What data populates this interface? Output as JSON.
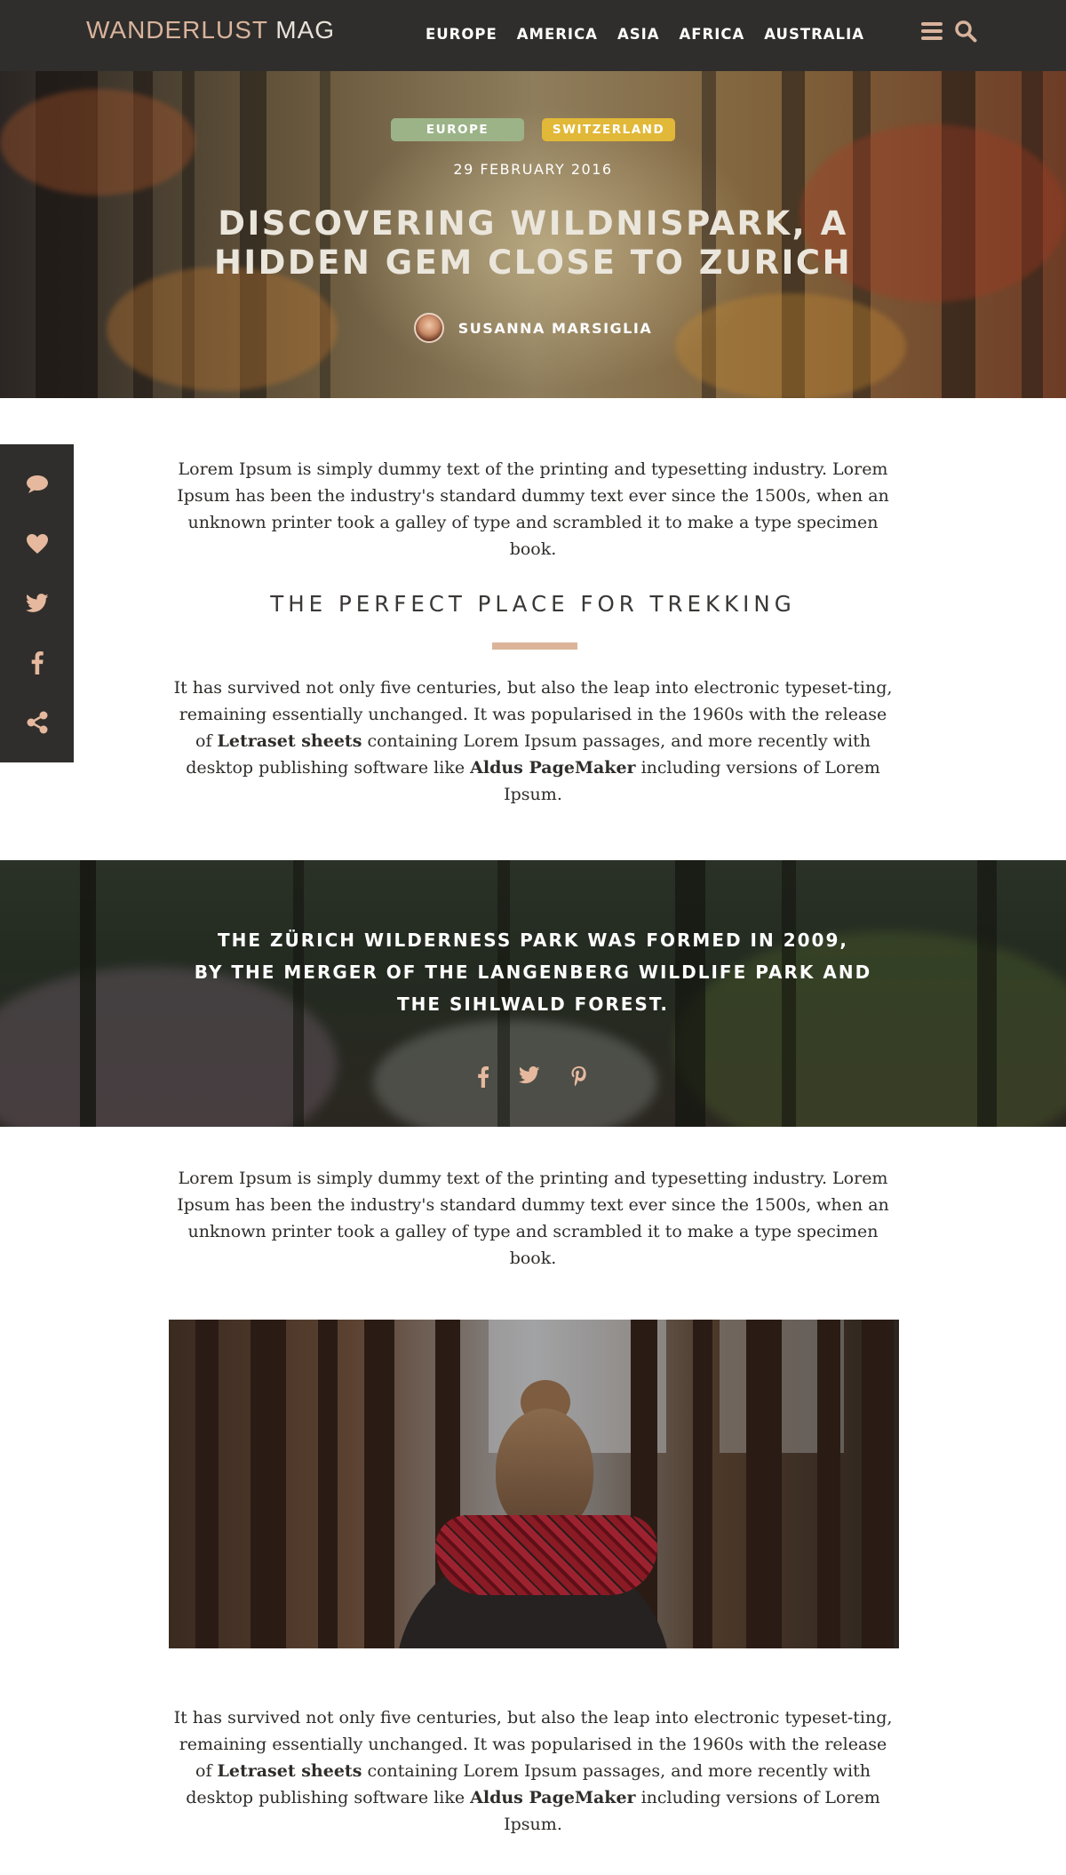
{
  "nav": {
    "logo_main": "WANDERLUST",
    "logo_sub": "MAG",
    "menu": [
      "EUROPE",
      "AMERICA",
      "ASIA",
      "AFRICA",
      "AUSTRALIA"
    ],
    "icons": [
      "hamburger-menu-icon",
      "search-icon"
    ]
  },
  "hero": {
    "tags": [
      "EUROPE",
      "SWITZERLAND"
    ],
    "date": "29 FEBRUARY 2016",
    "title": "DISCOVERING WILDNISPARK, A HIDDEN GEM CLOSE TO ZURICH",
    "author": "SUSANNA MARSIGLIA"
  },
  "share_sidebar": {
    "icons": [
      "comment-icon",
      "heart-icon",
      "twitter-icon",
      "facebook-icon",
      "share-icon"
    ]
  },
  "article": {
    "intro": "Lorem Ipsum is simply dummy text of the printing and typesetting industry. Lorem Ipsum has been the industry's standard dummy text ever since the 1500s, when an unknown printer took a galley of type and scrambled it to make a type specimen book.",
    "heading": "THE PERFECT PLACE FOR TREKKING",
    "body": {
      "part1": "It has survived not only five centuries, but also the leap into electronic typeset-ting, remaining essentially unchanged. It was popularised in the 1960s with the release of ",
      "bold1": "Letraset sheets",
      "part2": " containing Lorem Ipsum passages, and more recently with desktop publishing software like ",
      "bold2": "Aldus PageMaker",
      "part3": " including versions of Lorem Ipsum."
    },
    "intro2": "Lorem Ipsum is simply dummy text of the printing and typesetting industry. Lorem Ipsum has been the industry's standard dummy text ever since the 1500s, when an unknown printer took a galley of type and scrambled it to make a type specimen book.",
    "body2": {
      "part1": "It has survived not only five centuries, but also the leap into electronic typeset-ting, remaining essentially unchanged. It was popularised in the 1960s with the release of ",
      "bold1": "Letraset sheets",
      "part2": " containing Lorem Ipsum passages, and more recently with desktop publishing software like ",
      "bold2": "Aldus PageMaker",
      "part3": " including versions of Lorem Ipsum."
    }
  },
  "quote": {
    "line1": "THE ZÜRICH WILDERNESS PARK WAS FORMED IN 2009,",
    "line2": "BY THE MERGER OF THE LANGENBERG WILDLIFE PARK AND",
    "line3": "THE SIHLWALD FOREST.",
    "social_icons": [
      "facebook-icon",
      "twitter-icon",
      "pinterest-icon"
    ]
  },
  "colors": {
    "accent": "#dcb49a",
    "nav_bg": "#2f2e2c",
    "tag_europe": "#9cb388",
    "tag_switzerland": "#e1b838"
  }
}
